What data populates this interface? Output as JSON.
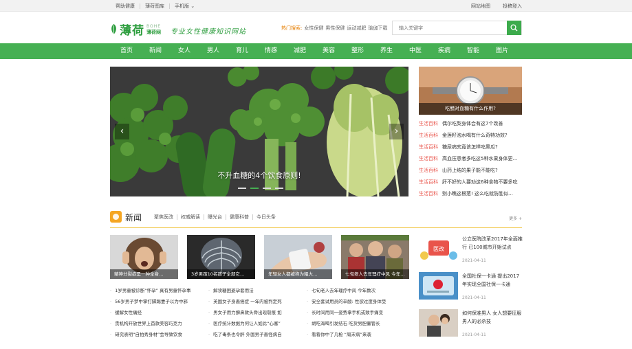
{
  "topbar": {
    "left": [
      "帮助健康",
      "薄荷图库",
      "手机版 ⌄"
    ],
    "right": [
      "网站地图",
      "投稿登入"
    ]
  },
  "header": {
    "logo_cn": "薄荷",
    "logo_en": "BOHE",
    "logo_sub": "薄荷网",
    "slogan": "专业女性健康知识网站",
    "hot_label": "热门搜索:",
    "hot_keywords": [
      "女性保健",
      "男性保健",
      "运动减肥",
      "瑜伽下载"
    ],
    "search_placeholder": "输入关键字"
  },
  "nav": [
    "首页",
    "新闻",
    "女人",
    "男人",
    "育儿",
    "情感",
    "减肥",
    "美容",
    "整形",
    "养生",
    "中医",
    "疾病",
    "智能",
    "图片"
  ],
  "banner": {
    "caption": "不升血糖的4个饮食原则!",
    "prev": "‹",
    "next": "›",
    "active_dot": 1,
    "dot_count": 4
  },
  "right_panel": {
    "thumb_caption": "吃醋对血糖有什么作用?",
    "items": [
      {
        "tag": "生活百科",
        "title": "偶尔吃梨身体会有这7个改善"
      },
      {
        "tag": "生活百科",
        "title": "金莲籽泡水喝有什么奇特功效?"
      },
      {
        "tag": "生活百科",
        "title": "糖尿病究竟该怎样吃黑瓜?"
      },
      {
        "tag": "生活百科",
        "title": "高血压患者多吃这5种水果身体更…"
      },
      {
        "tag": "生活百科",
        "title": "山药上结的果子能不能吃?"
      },
      {
        "tag": "生活百科",
        "title": "肝不好的人要劝这6种食物不要多吃"
      },
      {
        "tag": "生活百科",
        "title": "别小瞧这根葱! 这么吃就防胜似…"
      }
    ]
  },
  "news": {
    "title": "新闻",
    "tabs": [
      "聚焦医改",
      "权威解读",
      "曝光台",
      "健康科普",
      "今日头条"
    ],
    "more": "更多 +",
    "thumbs": [
      "精神分裂症是一种全身…",
      "3岁男孩10名孩子全部它…",
      "年轻女人都被称为粗大…",
      "七旬老人去年理疗中风 今年…"
    ],
    "columns": [
      [
        "1岁男童被诊断“怀孕” 真有男童怀孕事",
        "56岁男子梦中掌打脚踢妻子以为中邪",
        "缓解女性痛经",
        "贵机构开放世界上首款美容巧克力",
        "研究表明“自拍秀身材”会导致饮食"
      ],
      [
        "解读糖困避孕套用法",
        "英国女子身患癌症 一年内被判定死",
        "男女子用力擤鼻致头骨出现裂痕 如",
        "医疗统计数据为何让人如此“心塞”",
        "吃了毒条也令醉 外国男子患怪病自"
      ],
      [
        "七旬老人去年理疗中风 今年数次",
        "安全套试用员的辛酸: 性欲过度身体受",
        "长时间用同一姿势拿手机或致手痛变",
        "胡吃海喝引发结石 吃货男胆囊管长",
        "看看你中了几枪 “周末病”来袭"
      ]
    ],
    "side": [
      {
        "title": "公立医院改革2017年全面推行 已100城市开始试点",
        "date": "2021-04-11"
      },
      {
        "title": "全国社保一卡通 提出2017年实现全国社保一卡通",
        "date": "2021-04-11"
      },
      {
        "title": "如何保准男人 女人想要征服男人的必杀技",
        "date": "2021-04-11"
      }
    ]
  },
  "colors": {
    "brand_green": "#46b053",
    "accent_red": "#e9544b",
    "accent_orange": "#e67e00"
  }
}
